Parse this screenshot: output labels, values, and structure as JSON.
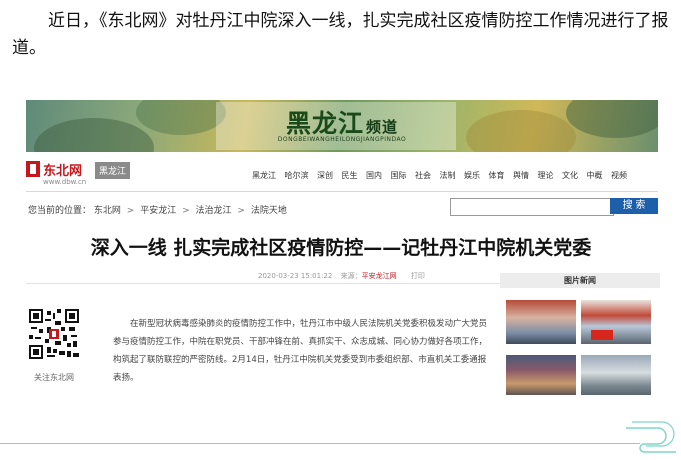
{
  "intro": {
    "text": "近日，《东北网》对牡丹江中院深入一线，扎实完成社区疫情防控工作情况进行了报道。"
  },
  "banner": {
    "title": "黑龙江",
    "subtitle": "频道",
    "pinyin": "DONGBEIWANGHEILONGJIANGPINDAO"
  },
  "site": {
    "logo_text": "东北网",
    "logo_url": "www.dbw.cn",
    "channel_tag": "黑龙江"
  },
  "nav": {
    "links": [
      "黑龙江",
      "哈尔滨",
      "深创",
      "民生",
      "国内",
      "国际",
      "社会",
      "法制",
      "娱乐",
      "体育",
      "舆情",
      "理论",
      "文化",
      "中概",
      "视频"
    ]
  },
  "breadcrumb": {
    "prefix": "您当前的位置：",
    "items": [
      "东北网",
      "平安龙江",
      "法治龙江",
      "法院天地"
    ],
    "separator": ">"
  },
  "search": {
    "placeholder": "",
    "button_label": "搜 索"
  },
  "article": {
    "headline": "深入一线 扎实完成社区疫情防控——记牡丹江中院机关党委",
    "date": "2020-03-23 15:01:22",
    "source_label": "来源：",
    "source": "平安龙江网",
    "print": "打印",
    "paragraph": "在新型冠状病毒感染肺炎的疫情防控工作中，牡丹江市中级人民法院机关党委积极发动广大党员参与疫情防控工作，中院在职党员、干部冲锋在前、真抓实干、众志成城、同心协力做好各项工作，构筑起了联防联控的严密防线。2月14日，牡丹江中院机关党委受到市委组织部、市直机关工委通报表扬。"
  },
  "qr": {
    "caption": "关注东北网"
  },
  "sidebar": {
    "heading": "图片新闻"
  },
  "colors": {
    "brand_red": "#c8161d",
    "search_blue": "#1d5fa8",
    "accent_teal": "#7fd6c8"
  }
}
